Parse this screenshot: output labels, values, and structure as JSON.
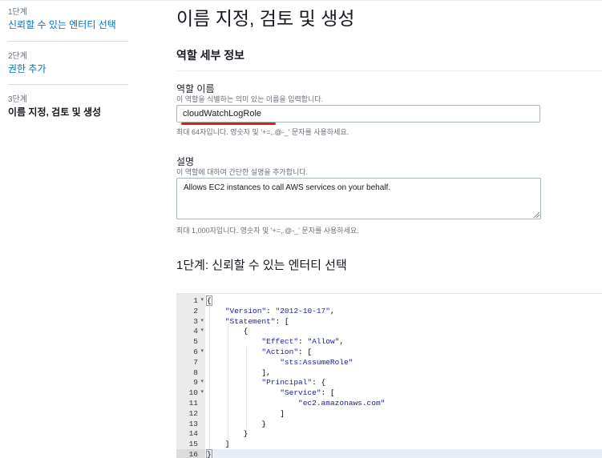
{
  "sidebar": {
    "steps": [
      {
        "num": "1단계",
        "label": "신뢰할 수 있는 엔터티 선택"
      },
      {
        "num": "2단계",
        "label": "권한 추가"
      },
      {
        "num": "3단계",
        "label": "이름 지정, 검토 및 생성"
      }
    ]
  },
  "main": {
    "title": "이름 지정, 검토 및 생성",
    "section_title": "역할 세부 정보",
    "role_name": {
      "label": "역할 이름",
      "description": "이 역할을 식별하는 의미 있는 이름을 입력합니다.",
      "value": "cloudWatchLogRole",
      "hint": "최대 64자입니다. 영숫자 및 '+=,.@-_' 문자를 사용하세요."
    },
    "description": {
      "label": "설명",
      "description": "이 역할에 대하여 간단한 설명을 추가합니다.",
      "value": "Allows EC2 instances to call AWS services on your behalf.",
      "hint": "최대 1,000자입니다. 영숫자 및 '+=,.@-_' 문자를 사용하세요."
    },
    "step1_title": "1단계: 신뢰할 수 있는 엔터티 선택"
  },
  "editor": {
    "lines": [
      {
        "n": "1",
        "fold": true,
        "text": "{"
      },
      {
        "n": "2",
        "fold": false,
        "text": "    \"Version\": \"2012-10-17\","
      },
      {
        "n": "3",
        "fold": true,
        "text": "    \"Statement\": ["
      },
      {
        "n": "4",
        "fold": true,
        "text": "        {"
      },
      {
        "n": "5",
        "fold": false,
        "text": "            \"Effect\": \"Allow\","
      },
      {
        "n": "6",
        "fold": true,
        "text": "            \"Action\": ["
      },
      {
        "n": "7",
        "fold": false,
        "text": "                \"sts:AssumeRole\""
      },
      {
        "n": "8",
        "fold": false,
        "text": "            ],"
      },
      {
        "n": "9",
        "fold": true,
        "text": "            \"Principal\": {"
      },
      {
        "n": "10",
        "fold": true,
        "text": "                \"Service\": ["
      },
      {
        "n": "11",
        "fold": false,
        "text": "                    \"ec2.amazonaws.com\""
      },
      {
        "n": "12",
        "fold": false,
        "text": "                ]"
      },
      {
        "n": "13",
        "fold": false,
        "text": "            }"
      },
      {
        "n": "14",
        "fold": false,
        "text": "        }"
      },
      {
        "n": "15",
        "fold": false,
        "text": "    ]"
      },
      {
        "n": "16",
        "fold": false,
        "text": "}"
      }
    ]
  },
  "colors": {
    "link": "#0073bb",
    "annotation_underline": "#e01b1b"
  }
}
